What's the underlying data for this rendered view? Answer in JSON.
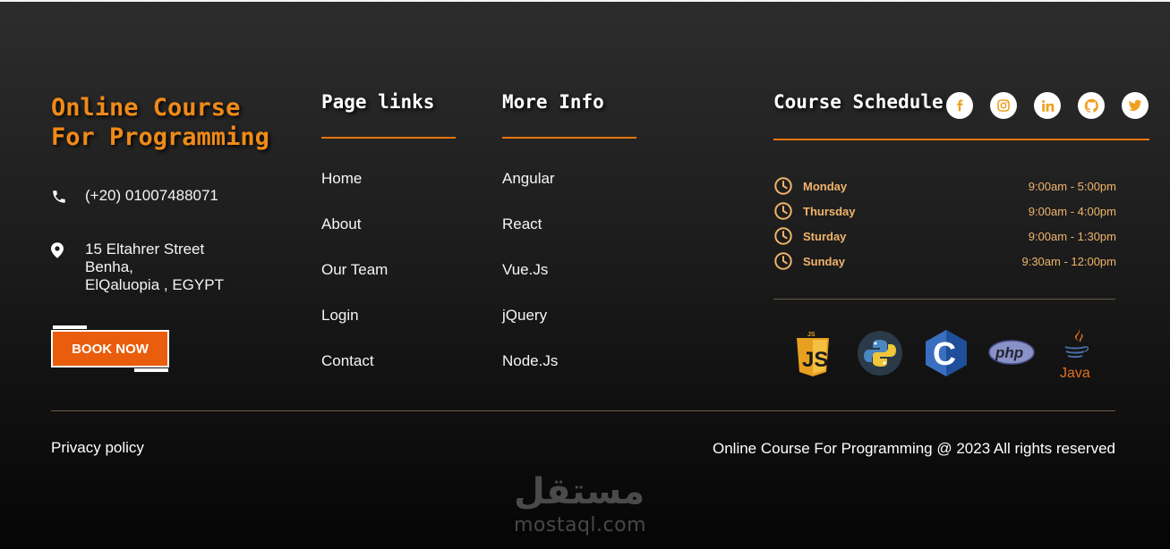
{
  "brand": {
    "title": "Online Course For Programming",
    "phone": "(+20) 01007488071",
    "address": [
      "15 Eltahrer Street",
      "Benha,",
      "ElQaluopia , EGYPT"
    ],
    "book_label": "BOOK NOW"
  },
  "page_links": {
    "title": "Page links",
    "items": [
      "Home",
      "About",
      "Our Team",
      "Login",
      "Contact"
    ]
  },
  "more_info": {
    "title": "More Info",
    "items": [
      "Angular",
      "React",
      "Vue.Js",
      "jQuery",
      "Node.Js"
    ]
  },
  "schedule": {
    "title": "Course Schedule",
    "rows": [
      {
        "day": "Monday",
        "hours": "9:00am - 5:00pm"
      },
      {
        "day": "Thursday",
        "hours": "9:00am - 4:00pm"
      },
      {
        "day": "Sturday",
        "hours": "9:00am - 1:30pm"
      },
      {
        "day": "Sunday",
        "hours": "9:30am - 12:00pm"
      }
    ]
  },
  "social": [
    "facebook-icon",
    "instagram-icon",
    "linkedin-icon",
    "github-icon",
    "twitter-icon"
  ],
  "tech_logos": {
    "js_badge": "JS",
    "js_letters": "JS",
    "c_letter": "C",
    "php": "php",
    "java": "Java"
  },
  "footer": {
    "privacy": "Privacy policy",
    "copyright": "Online Course For Programming @ 2023 All rights reserved"
  },
  "watermark": {
    "arabic": "مستقل",
    "latin": "mostaql.com"
  },
  "colors": {
    "accent": "#e9750f",
    "brand_title": "#f08a18",
    "button": "#e95d0c",
    "schedule_text": "#f0b46a",
    "social_icon": "#f0a020"
  }
}
